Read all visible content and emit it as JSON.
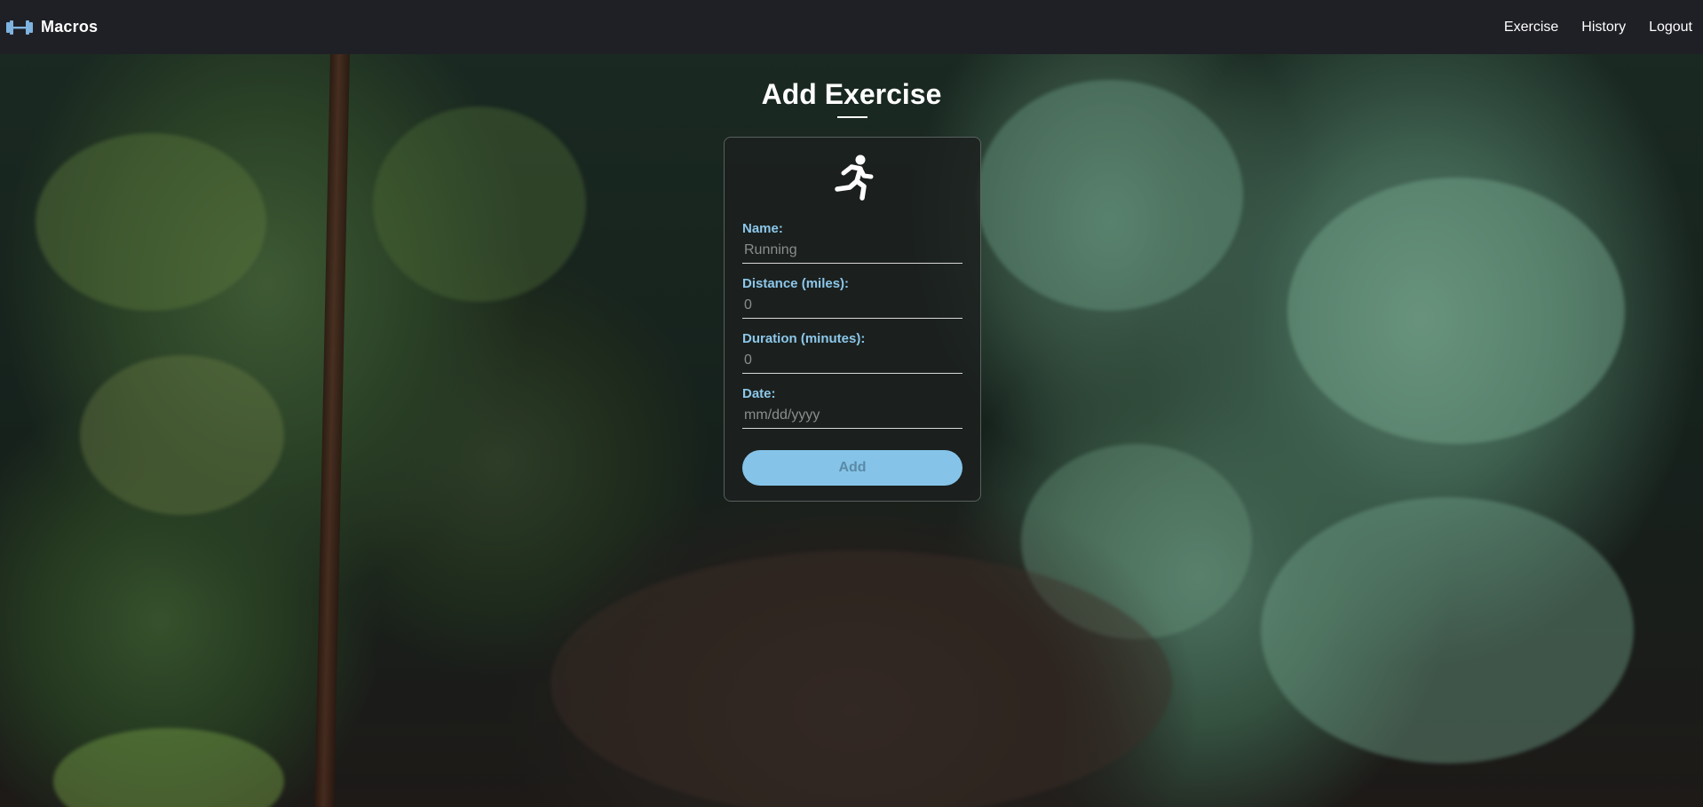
{
  "navbar": {
    "brand_icon": "dumbbell-icon",
    "brand_text": "Macros",
    "links": [
      {
        "label": "Exercise"
      },
      {
        "label": "History"
      },
      {
        "label": "Logout"
      }
    ]
  },
  "main": {
    "title": "Add Exercise",
    "card_icon": "runner-icon",
    "fields": {
      "name": {
        "label": "Name:",
        "placeholder": "Running"
      },
      "distance": {
        "label": "Distance (miles):",
        "placeholder": "0"
      },
      "duration": {
        "label": "Duration (minutes):",
        "placeholder": "0"
      },
      "date": {
        "label": "Date:",
        "placeholder": "mm/dd/yyyy"
      }
    },
    "submit_label": "Add"
  },
  "colors": {
    "navbar_bg": "#1f2025",
    "label": "#8cc7ea",
    "button_bg": "#85c4e8",
    "button_text": "#5a8aa6",
    "brand_icon": "#7fb3e0"
  }
}
